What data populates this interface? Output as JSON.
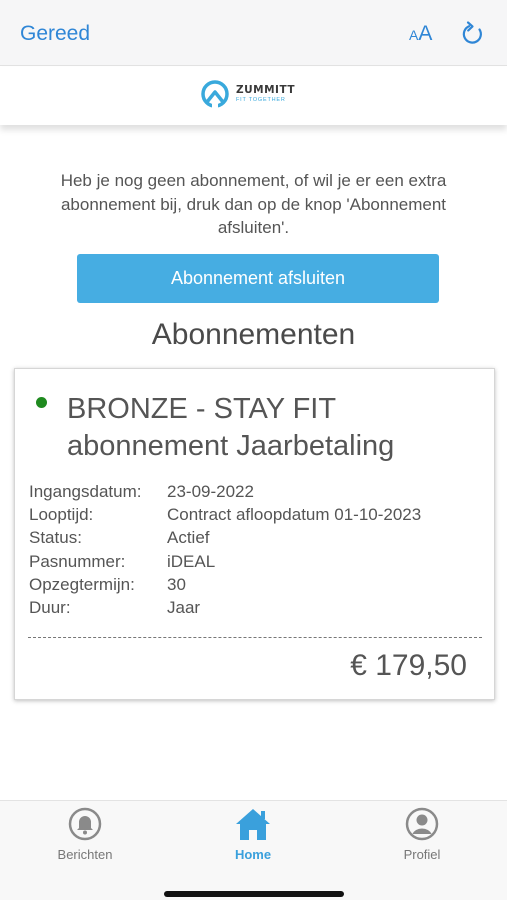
{
  "toolbar": {
    "done_label": "Gereed",
    "text_size_small": "A",
    "text_size_big": "A",
    "reload_icon": "reload-icon"
  },
  "brand": {
    "name": "ZUMMITT",
    "tagline": "FIT TOGETHER",
    "accent_color": "#39a9dc"
  },
  "intro_text": "Heb je nog geen abonnement, of wil je er een extra abonnement bij, druk dan op de knop 'Abonnement afsluiten'.",
  "cta_label": "Abonnement afsluiten",
  "section_title": "Abonnementen",
  "subscription": {
    "status_color": "#1f8a1f",
    "title": "BRONZE - STAY FIT abonnement Jaarbetaling",
    "details": [
      {
        "label": "Ingangsdatum:",
        "value": "23-09-2022"
      },
      {
        "label": "Looptijd:",
        "value": "Contract afloopdatum 01-10-2023"
      },
      {
        "label": "Status:",
        "value": "Actief"
      },
      {
        "label": "Pasnummer:",
        "value": "iDEAL"
      },
      {
        "label": "Opzegtermijn:",
        "value": "30"
      },
      {
        "label": "Duur:",
        "value": "Jaar"
      }
    ],
    "price": "€ 179,50"
  },
  "tabbar": {
    "items": [
      {
        "label": "Berichten",
        "icon": "bell-icon",
        "active": false
      },
      {
        "label": "Home",
        "icon": "home-icon",
        "active": true
      },
      {
        "label": "Profiel",
        "icon": "user-icon",
        "active": false
      }
    ],
    "active_color": "#3aa0dc"
  }
}
